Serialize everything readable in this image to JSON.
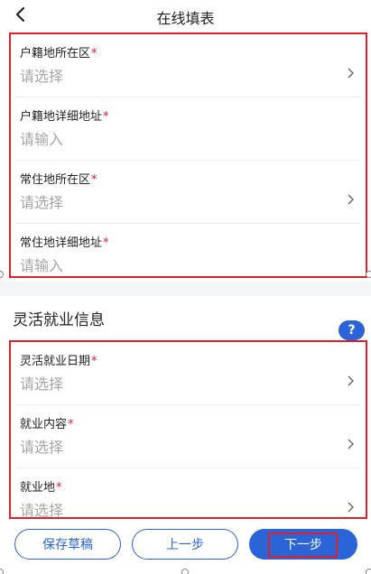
{
  "header": {
    "title": "在线填表",
    "back_icon": "chevron-left-icon"
  },
  "section1": {
    "fields": [
      {
        "label": "户籍地所在区",
        "required": "*",
        "value": "请选择",
        "kind": "select"
      },
      {
        "label": "户籍地详细地址",
        "required": "*",
        "value": "请输入",
        "kind": "input"
      },
      {
        "label": "常住地所在区",
        "required": "*",
        "value": "请选择",
        "kind": "select"
      },
      {
        "label": "常住地详细地址",
        "required": "*",
        "value": "请输入",
        "kind": "input"
      }
    ]
  },
  "section2": {
    "title": "灵活就业信息",
    "fields": [
      {
        "label": "灵活就业日期",
        "required": "*",
        "value": "请选择",
        "kind": "select"
      },
      {
        "label": "就业内容",
        "required": "*",
        "value": "请选择",
        "kind": "select"
      },
      {
        "label": "就业地",
        "required": "*",
        "value": "请选择",
        "kind": "select"
      }
    ]
  },
  "help": {
    "label": "?"
  },
  "footer": {
    "save_label": "保存草稿",
    "prev_label": "上一步",
    "next_label": "下一步"
  },
  "colors": {
    "accent": "#2a64d6",
    "required": "#e0202a",
    "placeholder": "#a6a6a6",
    "highlight_box": "#e0202a"
  }
}
